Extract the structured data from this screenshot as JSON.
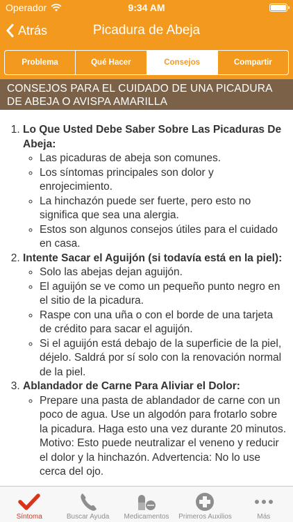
{
  "status_bar": {
    "carrier": "Operador",
    "time": "9:34 AM"
  },
  "nav": {
    "back_label": "Atrás",
    "title": "Picadura de Abeja"
  },
  "segments": [
    {
      "label": "Problema",
      "active": false
    },
    {
      "label": "Qué Hacer",
      "active": false
    },
    {
      "label": "Consejos",
      "active": true
    },
    {
      "label": "Compartir",
      "active": false
    }
  ],
  "header": {
    "title": "CONSEJOS PARA EL CUIDADO DE UNA PICADURA DE ABEJA O AVISPA AMARILLA"
  },
  "sections": [
    {
      "title": "Lo Que Usted Debe Saber Sobre Las Picaduras De Abeja:",
      "items": [
        "Las picaduras de abeja son comunes.",
        "Los síntomas principales son dolor y enrojecimiento.",
        "La hinchazón puede ser fuerte, pero esto no significa que sea una alergia.",
        "Estos son algunos consejos útiles para el cuidado en casa."
      ]
    },
    {
      "title": "Intente Sacar el Aguijón (si todavía está en la piel):",
      "items": [
        "Solo las abejas dejan aguijón.",
        "El aguijón se ve como un pequeño punto negro en el sitio de la picadura.",
        "Raspe con una uña o con el borde de una tarjeta de crédito para sacar el aguijón.",
        "Si el aguijón está debajo de la superficie de la piel, déjelo. Saldrá por sí solo con la renovación normal de la piel."
      ]
    },
    {
      "title": "Ablandador de Carne Para Aliviar el Dolor:",
      "items": [
        "Prepare una pasta de ablandador de carne con un poco de agua. Use un algodón para frotarlo sobre la picadura. Haga esto una vez durante 20 minutos. Motivo: Esto puede neutralizar el veneno y reducir el dolor y la hinchazón. Advertencia: No lo use cerca del ojo."
      ]
    }
  ],
  "tabs": [
    {
      "label": "Síntoma",
      "icon": "checkmark-icon",
      "active": true
    },
    {
      "label": "Buscar Ayuda",
      "icon": "phone-icon",
      "active": false
    },
    {
      "label": "Medicamentos",
      "icon": "pills-icon",
      "active": false
    },
    {
      "label": "Primeros Auxilios",
      "icon": "first-aid-icon",
      "active": false
    },
    {
      "label": "Más",
      "icon": "more-icon",
      "active": false
    }
  ],
  "colors": {
    "brand_orange": "#f39a1e",
    "header_brown": "#7a6148",
    "active_tab": "#d9341a"
  }
}
